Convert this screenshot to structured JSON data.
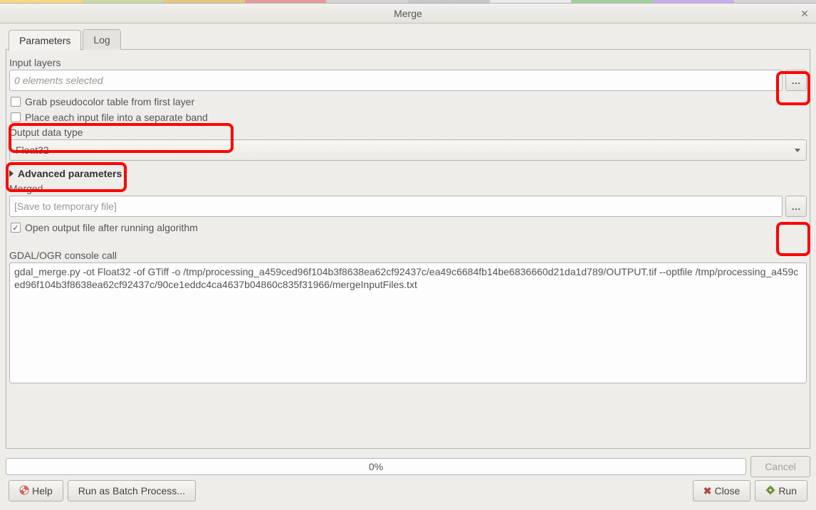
{
  "window": {
    "title": "Merge"
  },
  "tabs": {
    "parameters": "Parameters",
    "log": "Log"
  },
  "form": {
    "input_layers_label": "Input layers",
    "input_layers_value": "0 elements selected",
    "browse_btn": "…",
    "cb_pseudocolor": "Grab pseudocolor table from first layer",
    "cb_separate_band": "Place each input file into a separate band",
    "output_dt_label": "Output data type",
    "output_dt_value": "Float32",
    "advanced_label": "Advanced parameters",
    "merged_label": "Merged",
    "merged_placeholder": "[Save to temporary file]",
    "cb_open_output": "Open output file after running algorithm",
    "console_label": "GDAL/OGR console call",
    "console_text": "gdal_merge.py -ot Float32 -of GTiff -o /tmp/processing_a459ced96f104b3f8638ea62cf92437c/ea49c6684fb14be6836660d21da1d789/OUTPUT.tif --optfile /tmp/processing_a459ced96f104b3f8638ea62cf92437c/90ce1eddc4ca4637b04860c835f31966/mergeInputFiles.txt"
  },
  "progress": {
    "text": "0%"
  },
  "buttons": {
    "help": "Help",
    "batch": "Run as Batch Process...",
    "cancel": "Cancel",
    "close": "Close",
    "run": "Run"
  }
}
